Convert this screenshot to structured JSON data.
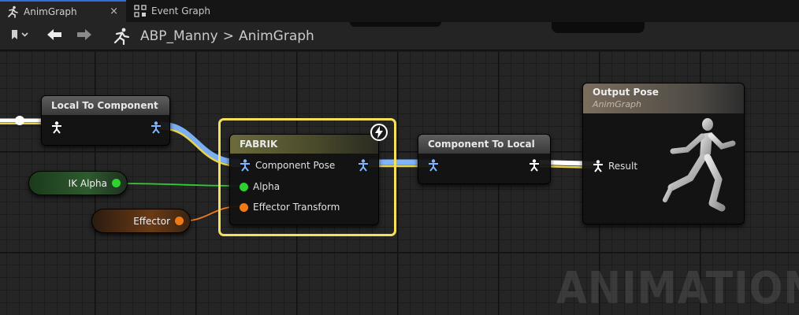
{
  "tabs": [
    {
      "label": "AnimGraph",
      "icon": "running-figure-icon",
      "active": true
    },
    {
      "label": "Event Graph",
      "icon": "event-graph-icon",
      "active": false
    }
  ],
  "tab_close": "×",
  "breadcrumb": {
    "asset": "ABP_Manny",
    "separator": ">",
    "graph": "AnimGraph"
  },
  "nodes": {
    "local_to_component": {
      "title": "Local To Component"
    },
    "fabrik": {
      "title": "FABRIK",
      "pins": [
        "Component Pose",
        "Alpha",
        "Effector Transform"
      ]
    },
    "component_to_local": {
      "title": "Component To Local"
    },
    "output_pose": {
      "title": "Output Pose",
      "subtitle": "AnimGraph",
      "pin": "Result"
    }
  },
  "variables": {
    "ik_alpha": {
      "label": "IK Alpha",
      "color": "#2ed12e"
    },
    "effector": {
      "label": "Effector",
      "color": "#f07a18"
    }
  },
  "colors": {
    "pose_wire": "#7fb6ff",
    "exec_wire": "#e8d34a",
    "selection": "#f4e05a",
    "accent": "#2f6fd6"
  },
  "watermark": "ANIMATION"
}
